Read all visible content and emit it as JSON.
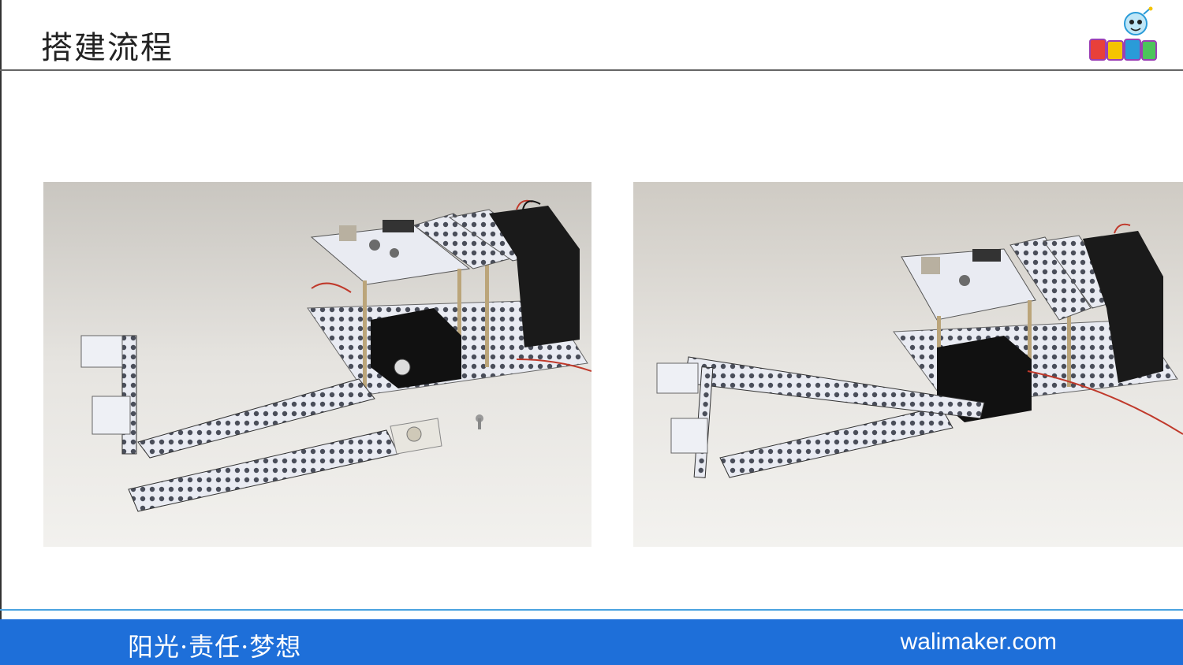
{
  "header": {
    "title": "搭建流程"
  },
  "logo": {
    "icon": "mascot-logo-icon",
    "colors": [
      "#e8403a",
      "#f5c400",
      "#2a9bd8",
      "#9b3fb5"
    ]
  },
  "photos": [
    {
      "icon": "robot-kit-photo-step1"
    },
    {
      "icon": "robot-kit-photo-step2"
    }
  ],
  "footer": {
    "slogan": "阳光·责任·梦想",
    "site": "walimaker.com",
    "bar_color": "#1e6fd9"
  }
}
